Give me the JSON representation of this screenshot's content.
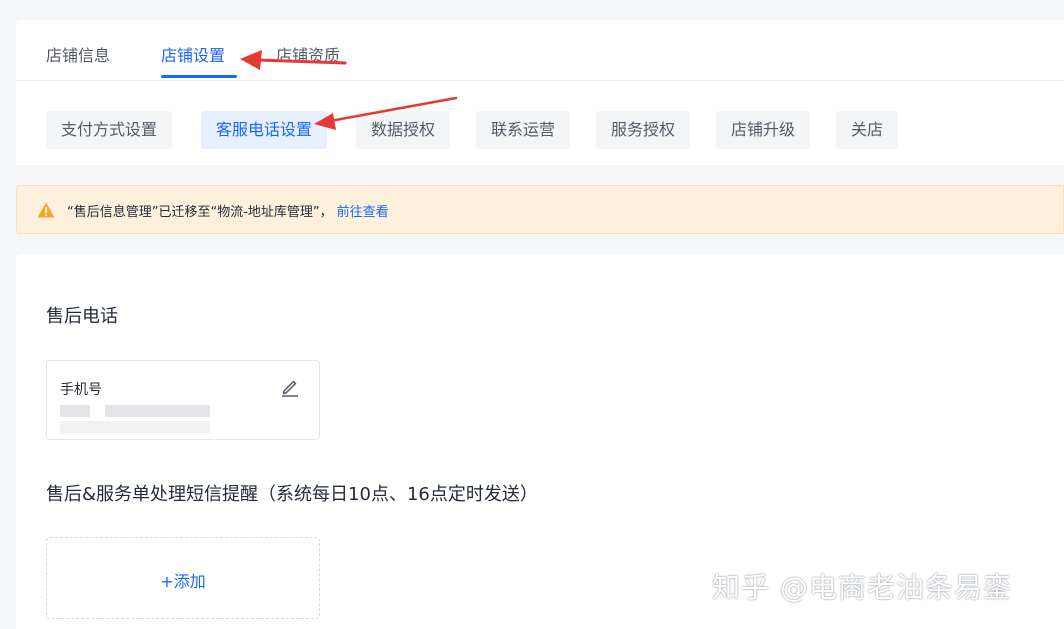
{
  "tabs": [
    {
      "label": "店铺信息",
      "active": false
    },
    {
      "label": "店铺设置",
      "active": true
    },
    {
      "label": "店铺资质",
      "active": false
    }
  ],
  "subtabs": [
    {
      "label": "支付方式设置",
      "active": false
    },
    {
      "label": "客服电话设置",
      "active": true
    },
    {
      "label": "数据授权",
      "active": false
    },
    {
      "label": "联系运营",
      "active": false
    },
    {
      "label": "服务授权",
      "active": false
    },
    {
      "label": "店铺升级",
      "active": false
    },
    {
      "label": "关店",
      "active": false
    }
  ],
  "notice": {
    "icon": "warning-icon",
    "text": "“售后信息管理”已迁移至“物流-地址库管理”，",
    "link": "前往查看"
  },
  "aftersale_phone": {
    "title": "售后电话",
    "label": "手机号",
    "edit_icon": "edit-icon"
  },
  "sms_reminder": {
    "title": "售后&服务单处理短信提醒（系统每日10点、16点定时发送）",
    "add_label": "+添加"
  },
  "watermark": "知乎 @电商老油条易銮",
  "colors": {
    "accent": "#1966ff",
    "notice_bg": "#fdf0dc",
    "warning": "#f5a623",
    "annotation_arrow": "#e53935"
  }
}
